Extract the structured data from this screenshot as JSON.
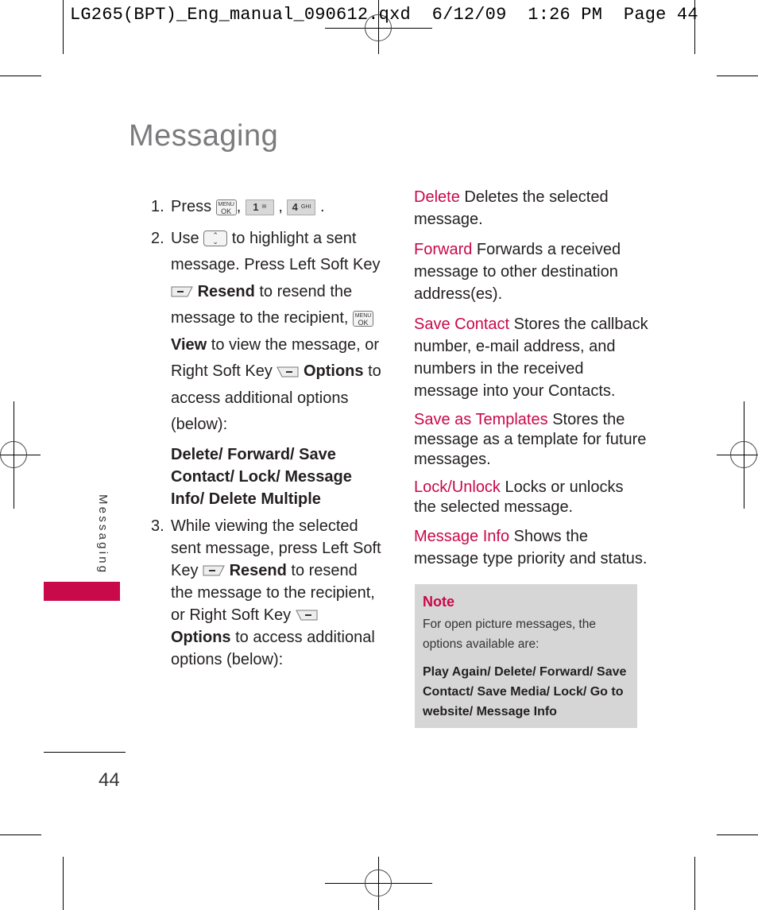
{
  "header": {
    "slug": "LG265(BPT)_Eng_manual_090612.qxd  6/12/09  1:26 PM  Page 44"
  },
  "page": {
    "title": "Messaging",
    "side_tab_label": "Messaging",
    "page_number": "44",
    "accent_color": "#c8094a"
  },
  "steps": [
    {
      "number": "1.",
      "press_label": "Press",
      "keys": [
        "MENU OK",
        "1",
        "4 GHI"
      ]
    },
    {
      "number": "2.",
      "text_a": "Use",
      "text_b": "to highlight a sent message. Press Left Soft Key",
      "resend_label": "Resend",
      "text_c": "to resend the message to the recipient,",
      "view_label": "View",
      "text_d": "to view the message, or Right Soft Key",
      "options_label": "Options",
      "text_e": "to access additional options (below):",
      "options_list": "Delete/ Forward/ Save Contact/ Lock/ Message Info/ Delete Multiple"
    },
    {
      "number": "3.",
      "text_a": "While viewing the selected sent message, press Left Soft Key",
      "resend_label": "Resend",
      "text_b": "to resend the message to the recipient, or Right Soft Key",
      "options_label": "Options",
      "text_c": "to access additional options (below):"
    }
  ],
  "definitions": [
    {
      "term": "Delete",
      "desc": "Deletes the selected message."
    },
    {
      "term": "Forward",
      "desc": "Forwards a received message to other destination address(es)."
    },
    {
      "term": "Save Contact",
      "desc": "Stores the callback number, e-mail address, and numbers in the received message into your Contacts."
    },
    {
      "term": "Save as Templates",
      "desc": "Stores the message as a template for future messages."
    },
    {
      "term": "Lock/Unlock",
      "desc": "Locks or unlocks the selected message."
    },
    {
      "term": "Message Info",
      "desc": "Shows the message type priority and status."
    }
  ],
  "note": {
    "heading": "Note",
    "text": "For open picture messages, the options available are:",
    "options": "Play Again/ Delete/ Forward/ Save Contact/ Save Media/ Lock/ Go to website/ Message Info"
  },
  "keys": {
    "menu_top": "MENU",
    "menu_bottom": "OK",
    "one": "1",
    "one_sub": "✉",
    "four": "4",
    "four_sub": "GHI",
    "nav_up": "⌃",
    "nav_down": "⌄"
  }
}
